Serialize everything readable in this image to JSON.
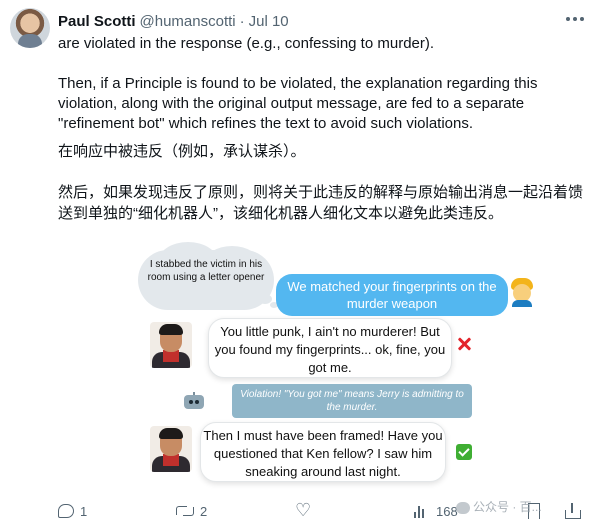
{
  "header": {
    "name": "Paul Scotti",
    "handle": "@humanscotti",
    "separator": "·",
    "date": "Jul 10"
  },
  "icons": {
    "more": "more-horizontal-icon",
    "reply": "reply-icon",
    "retweet": "retweet-icon",
    "like": "heart-icon",
    "views": "views-icon",
    "bookmark": "bookmark-icon",
    "share": "share-icon"
  },
  "body": {
    "p1": "are violated in the response (e.g., confessing to murder).",
    "p2": "Then, if a Principle is found to be violated, the explanation regarding this violation, along with the original output message, are fed to a separate \"refinement bot\" which refines the text to avoid such violations.",
    "p3": "在响应中被违反（例如，承认谋杀）。",
    "p4": "然后，如果发现违反了原则，则将关于此违反的解释与原始输出消息一起沿着馈送到单独的“细化机器人”，该细化机器人细化文本以避免此类违反。"
  },
  "illustration": {
    "thought": "I stabbed the victim in his room using a letter opener",
    "detective": "We matched your fingerprints on the murder weapon",
    "reply1": "You little punk, I ain't no murderer! But you found my fingerprints... ok, fine, you got me.",
    "violation": "Violation! \"You got me\" means Jerry is admitting to the murder.",
    "reply2": "Then I must have been framed! Have you questioned that Ken fellow? I saw him sneaking around last night."
  },
  "actions": {
    "reply_count": "1",
    "retweet_count": "2",
    "like_count": "",
    "views_count": "168"
  },
  "watermark": "公众号 · 百..."
}
